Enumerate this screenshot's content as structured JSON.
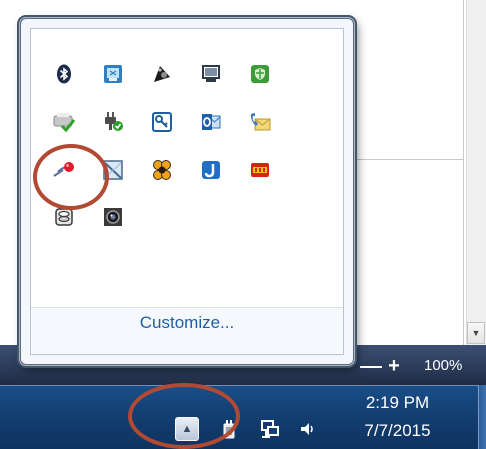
{
  "flyout": {
    "customize_label": "Customize...",
    "icons": [
      {
        "name": "bluetooth-icon"
      },
      {
        "name": "windows-mobility-icon"
      },
      {
        "name": "audio-manager-icon"
      },
      {
        "name": "display-monitor-icon"
      },
      {
        "name": "security-shield-icon"
      },
      {
        "name": "printer-check-icon"
      },
      {
        "name": "power-plug-icon"
      },
      {
        "name": "key-app-icon"
      },
      {
        "name": "outlook-icon"
      },
      {
        "name": "phone-call-icon"
      },
      {
        "name": "pushpin-app-icon"
      },
      {
        "name": "remote-desktop-icon"
      },
      {
        "name": "flower-app-icon"
      },
      {
        "name": "hook-app-icon"
      },
      {
        "name": "cc4-app-icon"
      },
      {
        "name": "disk-drive-icon"
      },
      {
        "name": "webcam-icon"
      }
    ]
  },
  "status_bar": {
    "zoom_level": "100%",
    "zoom_plus": "+"
  },
  "taskbar": {
    "show_hidden_icon": "▲",
    "clock_time": "2:19 PM",
    "clock_date": "7/7/2015"
  },
  "scrollbar": {
    "down_arrow": "▼"
  },
  "colors": {
    "annotation": "#b24a33",
    "link": "#1e5fa8",
    "taskbar": "#133f72"
  }
}
